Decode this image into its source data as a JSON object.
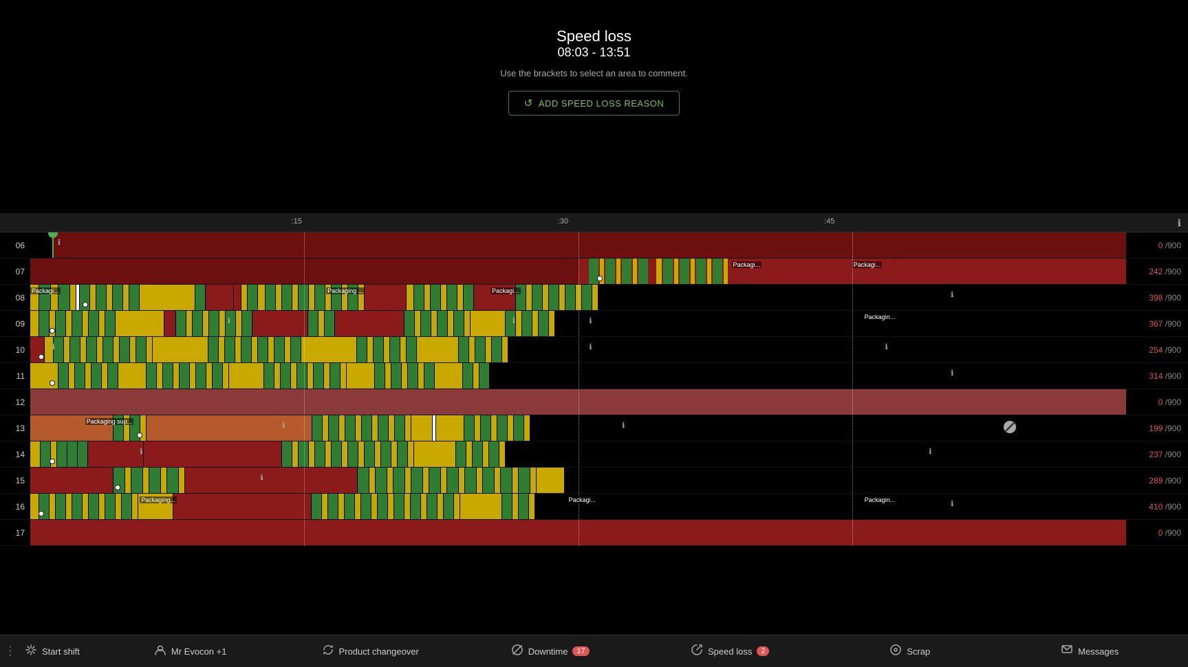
{
  "header": {
    "title": "Speed loss",
    "time_range": "08:03 - 13:51",
    "subtitle": "Use the brackets to select an area to comment.",
    "close_label": "×",
    "add_reason_label": "ADD SPEED LOSS REASON"
  },
  "timeline": {
    "ticks": [
      ":15",
      ":30",
      ":45"
    ],
    "tick_positions": [
      "25%",
      "50%",
      "75%"
    ]
  },
  "rows": [
    {
      "hour": "06",
      "count": "0",
      "total": "900",
      "count_color": "#e05555"
    },
    {
      "hour": "07",
      "count": "242",
      "total": "900",
      "count_color": "#e05555"
    },
    {
      "hour": "08",
      "count": "398",
      "total": "900",
      "count_color": "#e05555"
    },
    {
      "hour": "09",
      "count": "367",
      "total": "900",
      "count_color": "#e05555"
    },
    {
      "hour": "10",
      "count": "254",
      "total": "900",
      "count_color": "#e05555"
    },
    {
      "hour": "11",
      "count": "314",
      "total": "900",
      "count_color": "#e05555"
    },
    {
      "hour": "12",
      "count": "0",
      "total": "900",
      "count_color": "#e05555"
    },
    {
      "hour": "13",
      "count": "199",
      "total": "900",
      "count_color": "#e05555"
    },
    {
      "hour": "14",
      "count": "237",
      "total": "900",
      "count_color": "#e05555"
    },
    {
      "hour": "15",
      "count": "289",
      "total": "900",
      "count_color": "#e05555"
    },
    {
      "hour": "16",
      "count": "410",
      "total": "900",
      "count_color": "#e05555"
    },
    {
      "hour": "17",
      "count": "0",
      "total": "900",
      "count_color": "#e05555"
    }
  ],
  "status_bar": {
    "menu_dots": "⋮",
    "items": [
      {
        "id": "start-shift",
        "icon": "↺",
        "label": "Start shift",
        "badge": null
      },
      {
        "id": "user",
        "icon": "👤",
        "label": "Mr Evocon +1",
        "badge": null
      },
      {
        "id": "product-changeover",
        "icon": "↻",
        "label": "Product changeover",
        "badge": null
      },
      {
        "id": "downtime",
        "icon": "⊘",
        "label": "Downtime",
        "badge": "17"
      },
      {
        "id": "speed-loss",
        "icon": "⚡",
        "label": "Speed loss",
        "badge": "2"
      },
      {
        "id": "scrap",
        "icon": "⊙",
        "label": "Scrap",
        "badge": null
      },
      {
        "id": "messages",
        "icon": "✉",
        "label": "Messages",
        "badge": null
      }
    ]
  }
}
